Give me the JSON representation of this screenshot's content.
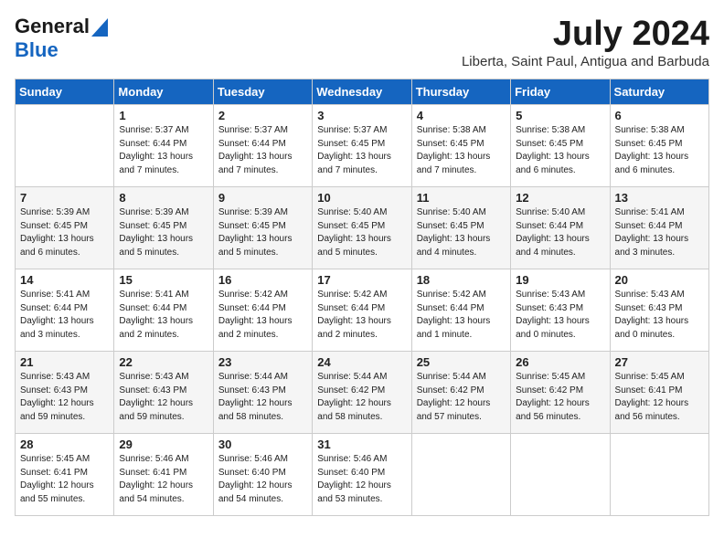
{
  "header": {
    "logo_line1": "General",
    "logo_line2": "Blue",
    "month": "July 2024",
    "location": "Liberta, Saint Paul, Antigua and Barbuda"
  },
  "days_of_week": [
    "Sunday",
    "Monday",
    "Tuesday",
    "Wednesday",
    "Thursday",
    "Friday",
    "Saturday"
  ],
  "weeks": [
    [
      {
        "day": "",
        "info": ""
      },
      {
        "day": "1",
        "info": "Sunrise: 5:37 AM\nSunset: 6:44 PM\nDaylight: 13 hours\nand 7 minutes."
      },
      {
        "day": "2",
        "info": "Sunrise: 5:37 AM\nSunset: 6:44 PM\nDaylight: 13 hours\nand 7 minutes."
      },
      {
        "day": "3",
        "info": "Sunrise: 5:37 AM\nSunset: 6:45 PM\nDaylight: 13 hours\nand 7 minutes."
      },
      {
        "day": "4",
        "info": "Sunrise: 5:38 AM\nSunset: 6:45 PM\nDaylight: 13 hours\nand 7 minutes."
      },
      {
        "day": "5",
        "info": "Sunrise: 5:38 AM\nSunset: 6:45 PM\nDaylight: 13 hours\nand 6 minutes."
      },
      {
        "day": "6",
        "info": "Sunrise: 5:38 AM\nSunset: 6:45 PM\nDaylight: 13 hours\nand 6 minutes."
      }
    ],
    [
      {
        "day": "7",
        "info": "Sunrise: 5:39 AM\nSunset: 6:45 PM\nDaylight: 13 hours\nand 6 minutes."
      },
      {
        "day": "8",
        "info": "Sunrise: 5:39 AM\nSunset: 6:45 PM\nDaylight: 13 hours\nand 5 minutes."
      },
      {
        "day": "9",
        "info": "Sunrise: 5:39 AM\nSunset: 6:45 PM\nDaylight: 13 hours\nand 5 minutes."
      },
      {
        "day": "10",
        "info": "Sunrise: 5:40 AM\nSunset: 6:45 PM\nDaylight: 13 hours\nand 5 minutes."
      },
      {
        "day": "11",
        "info": "Sunrise: 5:40 AM\nSunset: 6:45 PM\nDaylight: 13 hours\nand 4 minutes."
      },
      {
        "day": "12",
        "info": "Sunrise: 5:40 AM\nSunset: 6:44 PM\nDaylight: 13 hours\nand 4 minutes."
      },
      {
        "day": "13",
        "info": "Sunrise: 5:41 AM\nSunset: 6:44 PM\nDaylight: 13 hours\nand 3 minutes."
      }
    ],
    [
      {
        "day": "14",
        "info": "Sunrise: 5:41 AM\nSunset: 6:44 PM\nDaylight: 13 hours\nand 3 minutes."
      },
      {
        "day": "15",
        "info": "Sunrise: 5:41 AM\nSunset: 6:44 PM\nDaylight: 13 hours\nand 2 minutes."
      },
      {
        "day": "16",
        "info": "Sunrise: 5:42 AM\nSunset: 6:44 PM\nDaylight: 13 hours\nand 2 minutes."
      },
      {
        "day": "17",
        "info": "Sunrise: 5:42 AM\nSunset: 6:44 PM\nDaylight: 13 hours\nand 2 minutes."
      },
      {
        "day": "18",
        "info": "Sunrise: 5:42 AM\nSunset: 6:44 PM\nDaylight: 13 hours\nand 1 minute."
      },
      {
        "day": "19",
        "info": "Sunrise: 5:43 AM\nSunset: 6:43 PM\nDaylight: 13 hours\nand 0 minutes."
      },
      {
        "day": "20",
        "info": "Sunrise: 5:43 AM\nSunset: 6:43 PM\nDaylight: 13 hours\nand 0 minutes."
      }
    ],
    [
      {
        "day": "21",
        "info": "Sunrise: 5:43 AM\nSunset: 6:43 PM\nDaylight: 12 hours\nand 59 minutes."
      },
      {
        "day": "22",
        "info": "Sunrise: 5:43 AM\nSunset: 6:43 PM\nDaylight: 12 hours\nand 59 minutes."
      },
      {
        "day": "23",
        "info": "Sunrise: 5:44 AM\nSunset: 6:43 PM\nDaylight: 12 hours\nand 58 minutes."
      },
      {
        "day": "24",
        "info": "Sunrise: 5:44 AM\nSunset: 6:42 PM\nDaylight: 12 hours\nand 58 minutes."
      },
      {
        "day": "25",
        "info": "Sunrise: 5:44 AM\nSunset: 6:42 PM\nDaylight: 12 hours\nand 57 minutes."
      },
      {
        "day": "26",
        "info": "Sunrise: 5:45 AM\nSunset: 6:42 PM\nDaylight: 12 hours\nand 56 minutes."
      },
      {
        "day": "27",
        "info": "Sunrise: 5:45 AM\nSunset: 6:41 PM\nDaylight: 12 hours\nand 56 minutes."
      }
    ],
    [
      {
        "day": "28",
        "info": "Sunrise: 5:45 AM\nSunset: 6:41 PM\nDaylight: 12 hours\nand 55 minutes."
      },
      {
        "day": "29",
        "info": "Sunrise: 5:46 AM\nSunset: 6:41 PM\nDaylight: 12 hours\nand 54 minutes."
      },
      {
        "day": "30",
        "info": "Sunrise: 5:46 AM\nSunset: 6:40 PM\nDaylight: 12 hours\nand 54 minutes."
      },
      {
        "day": "31",
        "info": "Sunrise: 5:46 AM\nSunset: 6:40 PM\nDaylight: 12 hours\nand 53 minutes."
      },
      {
        "day": "",
        "info": ""
      },
      {
        "day": "",
        "info": ""
      },
      {
        "day": "",
        "info": ""
      }
    ]
  ]
}
